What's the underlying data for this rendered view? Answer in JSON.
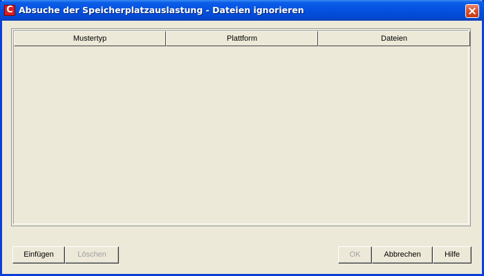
{
  "window": {
    "title": "Absuche der Speicherplatzauslastung - Dateien ignorieren",
    "app_icon_letter": "C",
    "app_icon": "app-logo-icon",
    "close_icon": "close-icon"
  },
  "table": {
    "columns": [
      "Mustertyp",
      "Plattform",
      "Dateien"
    ],
    "rows": []
  },
  "buttons": {
    "insert": "Einfügen",
    "delete": "Löschen",
    "ok": "OK",
    "cancel": "Abbrechen",
    "help": "Hilfe"
  },
  "colors": {
    "titlebar": "#0450E0",
    "dialog_bg": "#ECE9D8",
    "close_button": "#D9502C",
    "disabled_text": "#A0A0A0"
  }
}
